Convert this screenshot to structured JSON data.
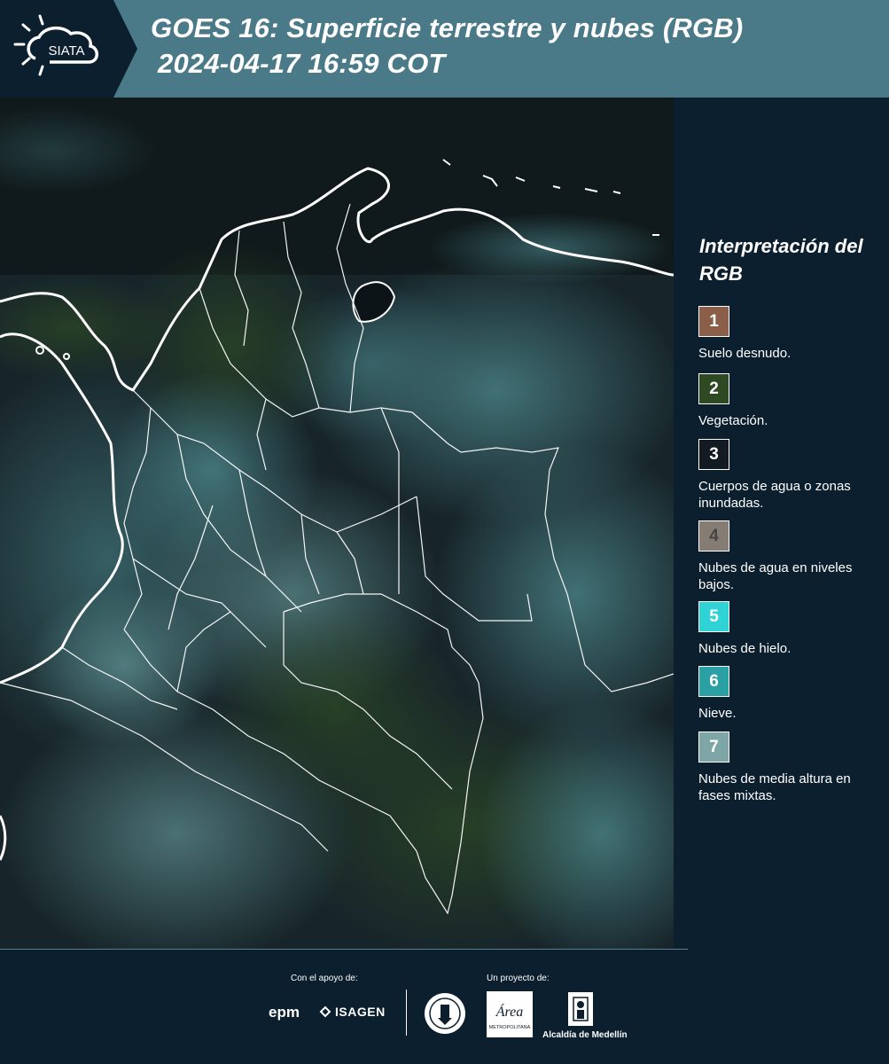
{
  "header": {
    "logo_text": "SIATA",
    "title_line1": "GOES 16: Superficie terrestre y nubes (RGB)",
    "title_line2": "2024-04-17 16:59 COT"
  },
  "legend": {
    "title": "Interpretación del RGB",
    "items": [
      {
        "number": "1",
        "label": "Suelo desnudo.",
        "color": "#8b5e49"
      },
      {
        "number": "2",
        "label": "Vegetación.",
        "color": "#2f4a22"
      },
      {
        "number": "3",
        "label": "Cuerpos de agua o zonas inundadas.",
        "color": "#141a21"
      },
      {
        "number": "4",
        "label": "Nubes de agua en niveles bajos.",
        "color": "#857d73"
      },
      {
        "number": "5",
        "label": "Nubes de hielo.",
        "color": "#2fd3d6"
      },
      {
        "number": "6",
        "label": "Nieve.",
        "color": "#2aa0a4"
      },
      {
        "number": "7",
        "label": "Nubes de media altura en fases mixtas.",
        "color": "#7fa6a6"
      }
    ]
  },
  "footer": {
    "support_caption": "Con el apoyo de:",
    "project_caption": "Un proyecto de:",
    "epm_logo": "epm",
    "isagen_logo": "ISAGEN",
    "area_logo": "Área",
    "area_subtitle": "METROPOLITANA",
    "alcaldia_logo": "Alcaldía de Medellín"
  },
  "colors": {
    "header_bg": "#4a7a88",
    "panel_bg": "#0b1f2e",
    "boundary_lines": "#ffffff"
  }
}
